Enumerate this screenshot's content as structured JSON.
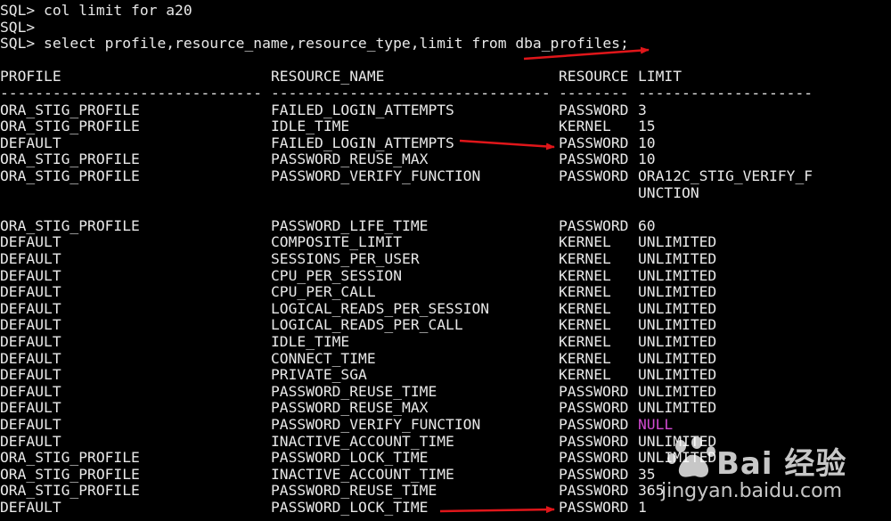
{
  "prompts": [
    "SQL> col limit for a20",
    "SQL>",
    "SQL> select profile,resource_name,resource_type,limit from dba_profiles;"
  ],
  "headers": {
    "profile": "PROFILE",
    "resource_name": "RESOURCE_NAME",
    "resource_type": "RESOURCE",
    "limit": "LIMIT"
  },
  "separators": {
    "profile": "------------------------------",
    "resource_name": "--------------------------------",
    "resource_type": "--------",
    "limit": "--------------------"
  },
  "rows": [
    {
      "profile": "ORA_STIG_PROFILE",
      "resource_name": "FAILED_LOGIN_ATTEMPTS",
      "resource_type": "PASSWORD",
      "limit": "3"
    },
    {
      "profile": "ORA_STIG_PROFILE",
      "resource_name": "IDLE_TIME",
      "resource_type": "KERNEL",
      "limit": "15"
    },
    {
      "profile": "DEFAULT",
      "resource_name": "FAILED_LOGIN_ATTEMPTS",
      "resource_type": "PASSWORD",
      "limit": "10"
    },
    {
      "profile": "ORA_STIG_PROFILE",
      "resource_name": "PASSWORD_REUSE_MAX",
      "resource_type": "PASSWORD",
      "limit": "10"
    },
    {
      "profile": "ORA_STIG_PROFILE",
      "resource_name": "PASSWORD_VERIFY_FUNCTION",
      "resource_type": "PASSWORD",
      "limit": "ORA12C_STIG_VERIFY_F",
      "limit_wrap": "UNCTION"
    },
    {
      "profile": "ORA_STIG_PROFILE",
      "resource_name": "PASSWORD_LIFE_TIME",
      "resource_type": "PASSWORD",
      "limit": "60"
    },
    {
      "profile": "DEFAULT",
      "resource_name": "COMPOSITE_LIMIT",
      "resource_type": "KERNEL",
      "limit": "UNLIMITED"
    },
    {
      "profile": "DEFAULT",
      "resource_name": "SESSIONS_PER_USER",
      "resource_type": "KERNEL",
      "limit": "UNLIMITED"
    },
    {
      "profile": "DEFAULT",
      "resource_name": "CPU_PER_SESSION",
      "resource_type": "KERNEL",
      "limit": "UNLIMITED"
    },
    {
      "profile": "DEFAULT",
      "resource_name": "CPU_PER_CALL",
      "resource_type": "KERNEL",
      "limit": "UNLIMITED"
    },
    {
      "profile": "DEFAULT",
      "resource_name": "LOGICAL_READS_PER_SESSION",
      "resource_type": "KERNEL",
      "limit": "UNLIMITED"
    },
    {
      "profile": "DEFAULT",
      "resource_name": "LOGICAL_READS_PER_CALL",
      "resource_type": "KERNEL",
      "limit": "UNLIMITED"
    },
    {
      "profile": "DEFAULT",
      "resource_name": "IDLE_TIME",
      "resource_type": "KERNEL",
      "limit": "UNLIMITED"
    },
    {
      "profile": "DEFAULT",
      "resource_name": "CONNECT_TIME",
      "resource_type": "KERNEL",
      "limit": "UNLIMITED"
    },
    {
      "profile": "DEFAULT",
      "resource_name": "PRIVATE_SGA",
      "resource_type": "KERNEL",
      "limit": "UNLIMITED"
    },
    {
      "profile": "DEFAULT",
      "resource_name": "PASSWORD_REUSE_TIME",
      "resource_type": "PASSWORD",
      "limit": "UNLIMITED"
    },
    {
      "profile": "DEFAULT",
      "resource_name": "PASSWORD_REUSE_MAX",
      "resource_type": "PASSWORD",
      "limit": "UNLIMITED"
    },
    {
      "profile": "DEFAULT",
      "resource_name": "PASSWORD_VERIFY_FUNCTION",
      "resource_type": "PASSWORD",
      "limit": "NULL",
      "limit_color": "#d24bd2"
    },
    {
      "profile": "DEFAULT",
      "resource_name": "INACTIVE_ACCOUNT_TIME",
      "resource_type": "PASSWORD",
      "limit": "UNLIMITED"
    },
    {
      "profile": "ORA_STIG_PROFILE",
      "resource_name": "PASSWORD_LOCK_TIME",
      "resource_type": "PASSWORD",
      "limit": "UNLIMITED"
    },
    {
      "profile": "ORA_STIG_PROFILE",
      "resource_name": "INACTIVE_ACCOUNT_TIME",
      "resource_type": "PASSWORD",
      "limit": "35"
    },
    {
      "profile": "ORA_STIG_PROFILE",
      "resource_name": "PASSWORD_REUSE_TIME",
      "resource_type": "PASSWORD",
      "limit": "365"
    },
    {
      "profile": "DEFAULT",
      "resource_name": "PASSWORD_LOCK_TIME",
      "resource_type": "PASSWORD",
      "limit": "1"
    }
  ],
  "watermark": {
    "brand": "Bai  经验",
    "url": "jingyan.baidu.com",
    "icon": "baidu-paw-icon"
  },
  "colors": {
    "background": "#000000",
    "text": "#e8e8e8",
    "null_value": "#d24bd2",
    "arrow": "#e0161a"
  }
}
